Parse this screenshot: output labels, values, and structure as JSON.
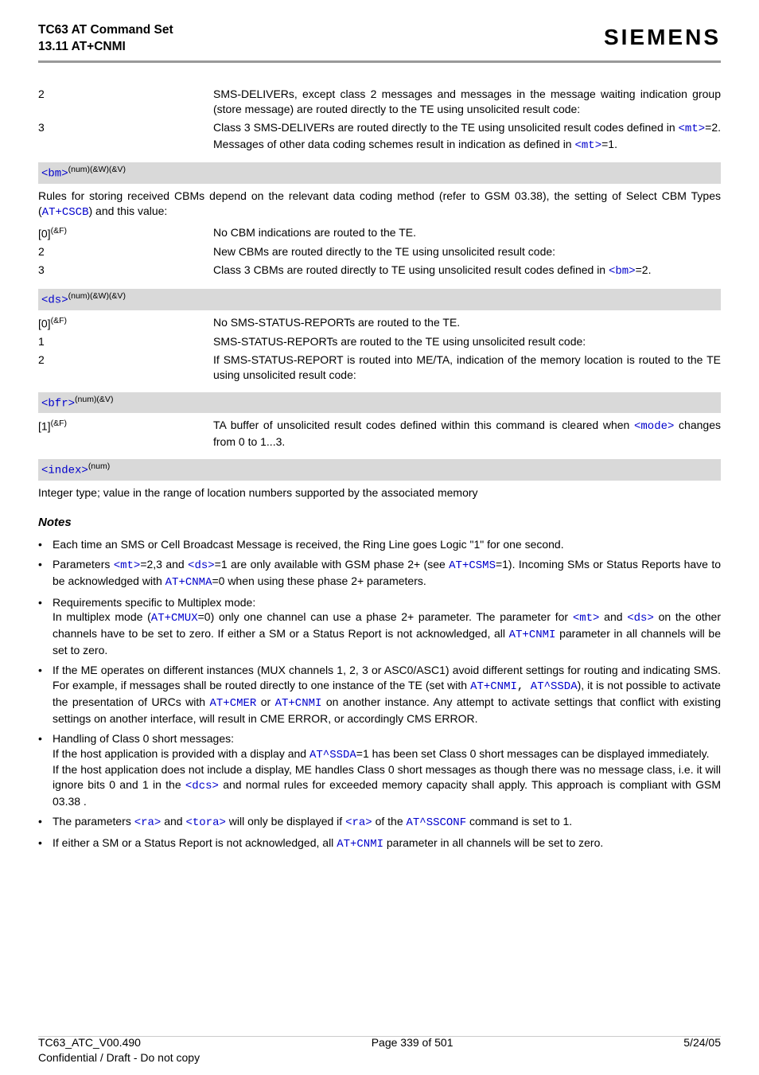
{
  "header": {
    "title": "TC63 AT Command Set",
    "section": "13.11 AT+CNMI",
    "brand": "SIEMENS"
  },
  "mt": {
    "row2": {
      "key": "2",
      "val_a": "SMS-DELIVERs, except class 2 messages and messages in the message waiting indication group (store message) are routed directly to the TE using unsolicited result code:"
    },
    "row3": {
      "key": "3",
      "val_a": "Class 3 SMS-DELIVERs are routed directly to the TE using unsolicited result codes defined in ",
      "mt_link": "<mt>",
      "val_b": "=2. Messages of other data coding schemes result in indication as defined in ",
      "val_c": "=1."
    }
  },
  "bm": {
    "bar": {
      "tag": "<bm>",
      "sup": "(num)(&W)(&V)"
    },
    "intro_a": "Rules for storing received CBMs depend on the relevant data coding method (refer to GSM 03.38), the setting of Select CBM Types (",
    "intro_link": "AT+CSCB",
    "intro_b": ") and this value:",
    "row0": {
      "key": "[0]",
      "keysup": "(&F)",
      "val": "No CBM indications are routed to the TE."
    },
    "row2": {
      "key": "2",
      "val": "New CBMs are routed directly to the TE using unsolicited result code:"
    },
    "row3": {
      "key": "3",
      "val_a": "Class 3 CBMs are routed directly to TE using unsolicited result codes defined in ",
      "bm_link": "<bm>",
      "val_b": "=2."
    }
  },
  "ds": {
    "bar": {
      "tag": "<ds>",
      "sup": "(num)(&W)(&V)"
    },
    "row0": {
      "key": "[0]",
      "keysup": "(&F)",
      "val": "No SMS-STATUS-REPORTs are routed to the TE."
    },
    "row1": {
      "key": "1",
      "val": "SMS-STATUS-REPORTs are routed to the TE using unsolicited result code:"
    },
    "row2": {
      "key": "2",
      "val": "If SMS-STATUS-REPORT is routed into ME/TA, indication of the memory location is routed to the TE using unsolicited result code:"
    }
  },
  "bfr": {
    "bar": {
      "tag": "<bfr>",
      "sup": "(num)(&V)"
    },
    "row1": {
      "key": "[1]",
      "keysup": "(&F)",
      "val_a": "TA buffer of unsolicited result codes defined within this command is cleared when ",
      "mode_link": "<mode>",
      "val_b": " changes from 0 to 1...3."
    }
  },
  "index": {
    "bar": {
      "tag": "<index>",
      "sup": "(num)"
    },
    "desc": "Integer type; value in the range of location numbers supported by the associated memory"
  },
  "notes": {
    "title": "Notes",
    "n1": "Each time an SMS or Cell Broadcast Message is received, the Ring Line goes Logic \"1\" for one second.",
    "n2": {
      "a": "Parameters ",
      "mt": "<mt>",
      "b": "=2,3 and ",
      "ds": "<ds>",
      "c": "=1 are only available with GSM phase 2+ (see ",
      "csms": "AT+CSMS",
      "d": "=1). Incoming SMs or Status Reports have to be acknowledged with ",
      "cnma": "AT+CNMA",
      "e": "=0 when using these phase 2+ parameters."
    },
    "n3": {
      "a": "Requirements specific to Multiplex mode:",
      "b": "In multiplex mode (",
      "cmux": "AT+CMUX",
      "c": "=0) only one channel can use a phase 2+ parameter. The parameter for ",
      "mt": "<mt>",
      "d": " and ",
      "ds": "<ds>",
      "e": " on the other channels have to be set to zero. If either a SM or a Status Report is not acknowledged, all ",
      "cnmi": "AT+CNMI",
      "f": " parameter in all channels will be set to zero."
    },
    "n4": {
      "a": "If the ME operates on different instances (MUX channels 1, 2, 3 or ASC0/ASC1) avoid different settings for routing and indicating SMS. For example, if messages shall be routed directly to one instance of the TE (set with ",
      "cnmi": "AT+CNMI",
      "sep": ", ",
      "ssda": "AT^SSDA",
      "b": "), it is not possible to activate the presentation of URCs with ",
      "cmer": "AT+CMER",
      "or": " or ",
      "cnmi2": "AT+CNMI",
      "c": " on another instance. Any attempt to activate settings that conflict with existing settings on another interface, will result in CME ERROR, or accordingly CMS ERROR."
    },
    "n5": {
      "a": "Handling of Class 0 short messages:",
      "b": "If the host application is provided with a display and ",
      "ssda": "AT^SSDA",
      "c": "=1 has been set Class 0 short messages can be displayed immediately.",
      "d": "If the host application does not include a display, ME handles Class 0 short messages as though there was no message class, i.e. it will ignore bits 0 and 1 in the ",
      "dcs": "<dcs>",
      "e": " and normal rules for exceeded memory capacity shall apply. This approach is compliant with  GSM 03.38 ."
    },
    "n6": {
      "a": "The parameters ",
      "ra": "<ra>",
      "b": " and ",
      "tora": "<tora>",
      "c": " will only be displayed if ",
      "ra2": "<ra>",
      "d": " of the ",
      "ssconf": "AT^SSCONF",
      "e": " command is set to 1."
    },
    "n7": {
      "a": "If either a SM or a Status Report is not acknowledged, all ",
      "cnmi": "AT+CNMI",
      "b": " parameter in all channels will be set to zero."
    }
  },
  "footer": {
    "left": "TC63_ATC_V00.490",
    "center": "Page 339 of 501",
    "right": "5/24/05",
    "conf": "Confidential / Draft - Do not copy"
  }
}
